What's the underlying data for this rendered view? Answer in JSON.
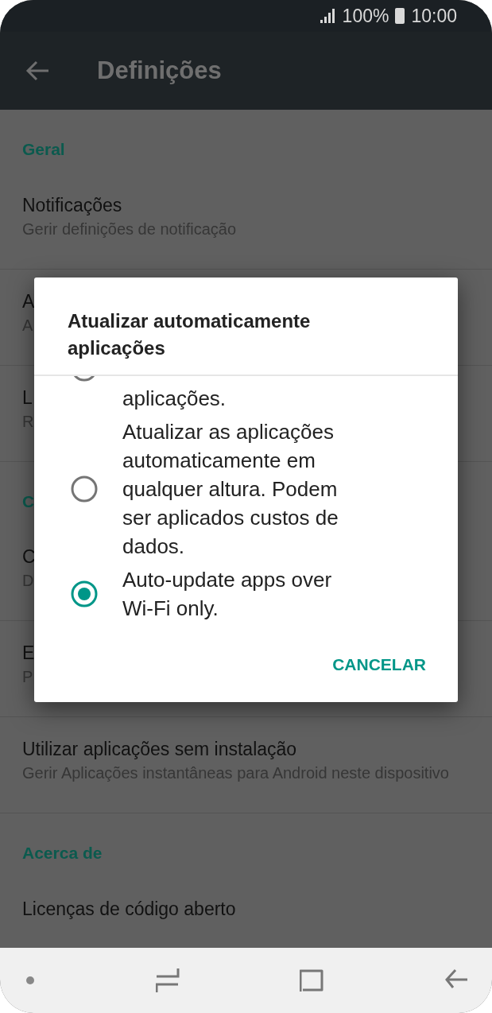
{
  "status_bar": {
    "battery_text": "100%",
    "time": "10:00"
  },
  "app_bar": {
    "title": "Definições"
  },
  "settings": [
    {
      "kind": "header",
      "title": "Geral"
    },
    {
      "kind": "item",
      "title": "Notificações",
      "subtitle": "Gerir definições de notificação"
    },
    {
      "kind": "item",
      "title": "A",
      "subtitle": "A"
    },
    {
      "kind": "item",
      "title": "L",
      "subtitle": "R"
    },
    {
      "kind": "header",
      "title": "C"
    },
    {
      "kind": "item",
      "title": "C",
      "subtitle": "D"
    },
    {
      "kind": "item",
      "title": "E",
      "subtitle": "P"
    },
    {
      "kind": "item",
      "title": "Utilizar aplicações sem instalação",
      "subtitle": "Gerir Aplicações instantâneas para Android neste dispositivo"
    },
    {
      "kind": "header",
      "title": "Acerca de"
    },
    {
      "kind": "item",
      "title": "Licenças de código aberto"
    }
  ],
  "dialog": {
    "title": "Atualizar automaticamente aplicações",
    "options": [
      {
        "kind": "partial",
        "label": "aplicações.",
        "selected": false
      },
      {
        "kind": "full",
        "label": "Atualizar as aplicações automaticamente em qualquer altura. Podem ser aplicados custos de dados.",
        "selected": false
      },
      {
        "kind": "full",
        "label": "Auto-update apps over Wi-Fi only.",
        "selected": true
      }
    ],
    "buttons": [
      "CANCELAR"
    ]
  }
}
